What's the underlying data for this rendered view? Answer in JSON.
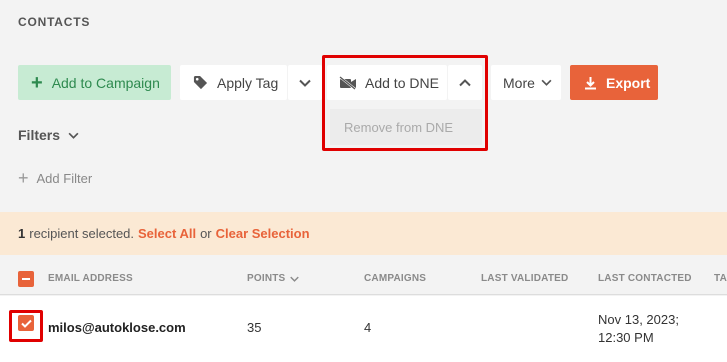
{
  "page": {
    "title": "CONTACTS"
  },
  "toolbar": {
    "add_to_campaign": "Add to Campaign",
    "apply_tag": "Apply Tag",
    "add_to_dne": "Add to DNE",
    "more": "More",
    "export": "Export"
  },
  "dne_menu": {
    "remove_from_dne": "Remove from DNE"
  },
  "filters": {
    "label": "Filters",
    "add_filter": "Add Filter"
  },
  "selection": {
    "count": "1",
    "text": "recipient selected.",
    "select_all": "Select All",
    "or": "or",
    "clear": "Clear Selection"
  },
  "table": {
    "columns": {
      "email": "EMAIL ADDRESS",
      "points": "POINTS",
      "campaigns": "CAMPAIGNS",
      "last_validated": "LAST VALIDATED",
      "last_contacted": "LAST CONTACTED",
      "tags": "TA"
    },
    "rows": [
      {
        "email": "milos@autoklose.com",
        "points": "35",
        "campaigns": "4",
        "last_validated": "",
        "last_contacted_line1": "Nov 13, 2023;",
        "last_contacted_line2": "12:30 PM"
      }
    ]
  },
  "colors": {
    "accent": "#e8633a",
    "campaign_bg": "#c7ebd3",
    "campaign_text": "#2e8a4f",
    "selection_bg": "#fbe9d4",
    "highlight": "#e00000"
  },
  "icons": [
    "plus-icon",
    "tag-icon",
    "chevron-down-icon",
    "video-off-icon",
    "chevron-up-icon",
    "download-icon"
  ]
}
